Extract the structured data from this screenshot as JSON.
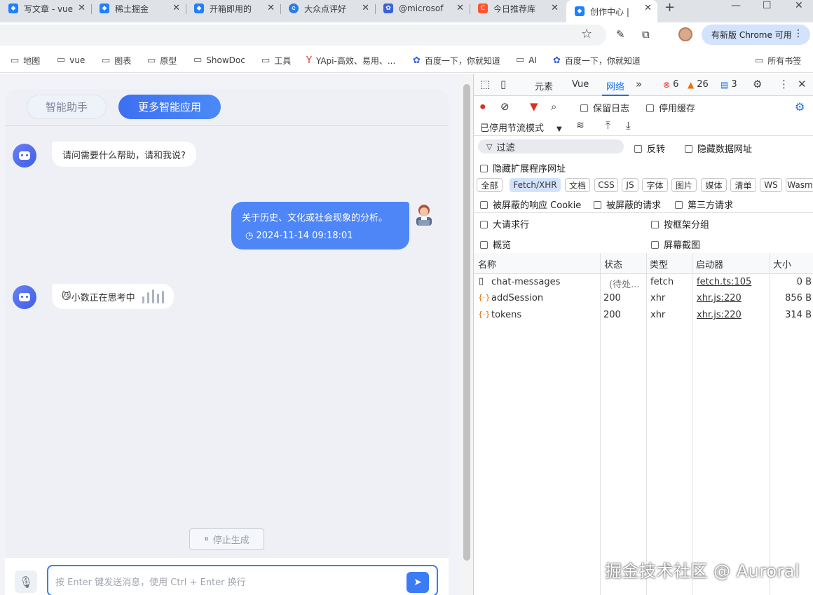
{
  "browser": {
    "tabs": [
      {
        "title": "写文章 - vue",
        "icon": "juejin-icon",
        "color": "#1e80ff"
      },
      {
        "title": "稀土掘金",
        "icon": "juejin-icon",
        "color": "#1e80ff"
      },
      {
        "title": "开箱即用的",
        "icon": "juejin-icon",
        "color": "#1e80ff"
      },
      {
        "title": "大众点评好",
        "icon": "edge-icon",
        "color": "#2b7de9"
      },
      {
        "title": "@microsof",
        "icon": "baidu-icon",
        "color": "#3a62d8"
      },
      {
        "title": "今日推荐库",
        "icon": "csdn-icon",
        "color": "#fc5531"
      },
      {
        "title": "创作中心 | ",
        "icon": "juejin-icon",
        "color": "#1e80ff"
      }
    ],
    "update_label": "有新版 Chrome 可用",
    "bookmarks": [
      {
        "label": "地图",
        "icon": "folder-icon"
      },
      {
        "label": "vue",
        "icon": "folder-icon"
      },
      {
        "label": "图表",
        "icon": "folder-icon"
      },
      {
        "label": "原型",
        "icon": "folder-icon"
      },
      {
        "label": "ShowDoc",
        "icon": "folder-icon"
      },
      {
        "label": "工具",
        "icon": "folder-icon"
      },
      {
        "label": "YApi-高效、易用、...",
        "icon": "yapi-icon"
      },
      {
        "label": "百度一下，你就知道",
        "icon": "baidu-icon"
      },
      {
        "label": "AI",
        "icon": "folder-icon"
      },
      {
        "label": "百度一下，你就知道",
        "icon": "baidu-icon"
      },
      {
        "label": "所有书签",
        "icon": "folder-icon"
      }
    ]
  },
  "chat": {
    "tab_assistant": "智能助手",
    "tab_more": "更多智能应用",
    "bot_greeting": "请问需要什么帮助，请和我说?",
    "user_message": "关于历史、文化或社会现象的分析。",
    "user_timestamp": "2024-11-14 09:18:01",
    "thinking_text": "小数正在思考中",
    "stop_label": "停止生成",
    "input_placeholder": "按 Enter 键发送消息，使用 Ctrl + Enter 换行"
  },
  "devtools": {
    "tabs": [
      "元素",
      "Vue",
      "网络"
    ],
    "active_tab": "网络",
    "errors": "6",
    "warnings": "26",
    "messages": "3",
    "preserve_log": "保留日志",
    "disable_cache": "停用缓存",
    "throttle": "已停用节流模式",
    "filter_placeholder": "过滤",
    "invert": "反转",
    "hide_data_urls": "隐藏数据网址",
    "hide_ext_urls": "隐藏扩展程序网址",
    "type_filters": [
      "全部",
      "Fetch/XHR",
      "文档",
      "CSS",
      "JS",
      "字体",
      "图片",
      "媒体",
      "清单",
      "WS",
      "Wasm"
    ],
    "selected_filter": "Fetch/XHR",
    "blocked_cookies": "被屏蔽的响应 Cookie",
    "blocked_requests": "被屏蔽的请求",
    "third_party": "第三方请求",
    "big_rows": "大请求行",
    "group_by_frame": "按框架分组",
    "overview": "概览",
    "screenshots": "屏幕截图",
    "columns": [
      "名称",
      "状态",
      "类型",
      "启动器",
      "大小"
    ],
    "requests": [
      {
        "name": "chat-messages",
        "status": "(待处...",
        "type": "fetch",
        "initiator": "fetch.ts:105",
        "size": "0 B"
      },
      {
        "name": "addSession",
        "status": "200",
        "type": "xhr",
        "initiator": "xhr.js:220",
        "size": "856 B"
      },
      {
        "name": "tokens",
        "status": "200",
        "type": "xhr",
        "initiator": "xhr.js:220",
        "size": "314 B"
      }
    ]
  },
  "watermark": "掘金技术社区 @ Auroral"
}
